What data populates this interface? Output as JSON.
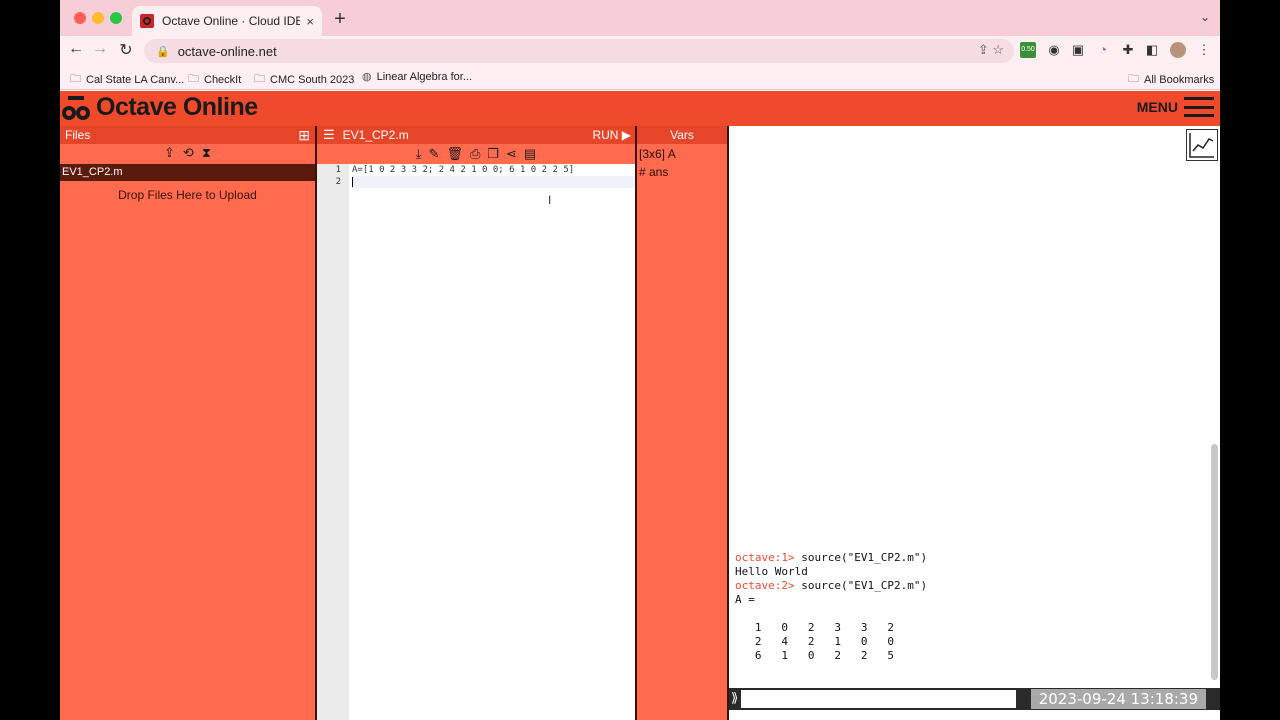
{
  "browser": {
    "tab_title": "Octave Online · Cloud IDE com",
    "tab_close": "×",
    "new_tab": "+",
    "tab_menu": "⌄",
    "url": "octave-online.net",
    "bookmarks": [
      "Cal State LA Canv...",
      "CheckIt",
      "CMC South 2023",
      "Linear Algebra for..."
    ],
    "all_bookmarks": "All Bookmarks",
    "ext_badge": "0.50"
  },
  "app": {
    "logo": "Octave Online",
    "menu": "MENU"
  },
  "files": {
    "title": "Files",
    "selected_file": "EV1_CP2.m",
    "dropzone": "Drop Files Here to Upload"
  },
  "editor": {
    "title": "EV1_CP2.m",
    "run": "RUN ▶",
    "line_numbers": [
      "1",
      "2"
    ],
    "lines": [
      "A=[1 0 2 3 3 2; 2 4 2 1 0 0; 6 1 0 2 2 5]",
      ""
    ]
  },
  "vars": {
    "title": "Vars",
    "items": [
      "[3x6] A",
      "# ans"
    ]
  },
  "console": {
    "prompt1": "octave:1>",
    "cmd1": " source(\"EV1_CP2.m\")",
    "out1": "Hello World",
    "prompt2": "octave:2>",
    "cmd2": " source(\"EV1_CP2.m\")",
    "out2": "A =",
    "matrix_rows": [
      "   1   0   2   3   3   2",
      "   2   4   2   1   0   0",
      "   6   1   0   2   2   5"
    ],
    "input_prompt": "⟫",
    "input_value": "",
    "timestamp": "2023-09-24  13:18:39"
  }
}
